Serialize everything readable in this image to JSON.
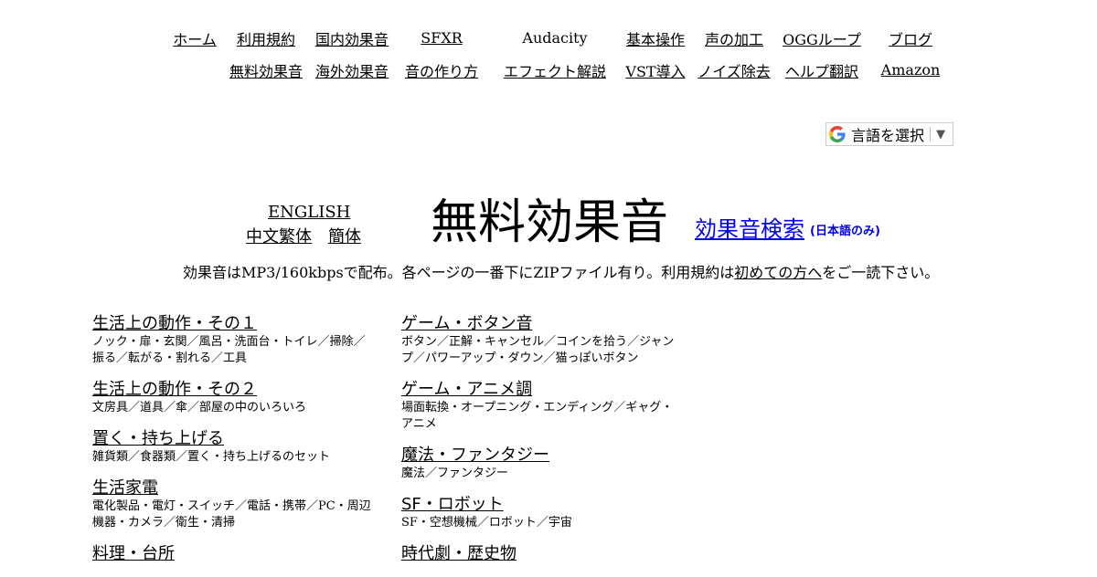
{
  "nav": {
    "row1": [
      "ホーム",
      "利用規約",
      "国内効果音",
      "SFXR",
      "Audacity",
      "基本操作",
      "声の加工",
      "OGGループ",
      "ブログ"
    ],
    "row2": [
      "",
      "無料効果音",
      "海外効果音",
      "音の作り方",
      "エフェクト解説",
      "VST導入",
      "ノイズ除去",
      "ヘルプ翻訳",
      "Amazon"
    ]
  },
  "translate": {
    "label": "言語を選択",
    "arrow": "▼"
  },
  "lang": {
    "english": "ENGLISH",
    "traditional": "中文繁体",
    "simplified": "簡体"
  },
  "title": "無料効果音",
  "search": {
    "link": "効果音検索",
    "note": "(日本語のみ)"
  },
  "intro": {
    "before": "効果音はMP3/160kbpsで配布。各ページの一番下にZIPファイル有り。利用規約は",
    "link": "初めての方へ",
    "after": "をご一読下さい。"
  },
  "categories_left": [
    {
      "title": "生活上の動作・その１",
      "desc": "ノック・扉・玄関／風呂・洗面台・トイレ／掃除／振る／転がる・割れる／工具"
    },
    {
      "title": "生活上の動作・その２",
      "desc": "文房具／道具／傘／部屋の中のいろいろ"
    },
    {
      "title": "置く・持ち上げる",
      "desc": "雑貨類／食器類／置く・持ち上げるのセット"
    },
    {
      "title": "生活家電",
      "desc": "電化製品・電灯・スイッチ／電話・携帯／PC・周辺機器・カメラ／衛生・清掃"
    },
    {
      "title": "料理・台所",
      "desc": ""
    }
  ],
  "categories_right": [
    {
      "title": "ゲーム・ボタン音",
      "desc": "ボタン／正解・キャンセル／コインを拾う／ジャンプ／パワーアップ・ダウン／猫っぽいボタン"
    },
    {
      "title": "ゲーム・アニメ調",
      "desc": "場面転換・オープニング・エンディング／ギャグ・アニメ"
    },
    {
      "title": "魔法・ファンタジー",
      "desc": "魔法／ファンタジー"
    },
    {
      "title": "SF・ロボット",
      "desc": "SF・空想機械／ロボット／宇宙"
    },
    {
      "title": "時代劇・歴史物",
      "desc": ""
    }
  ]
}
